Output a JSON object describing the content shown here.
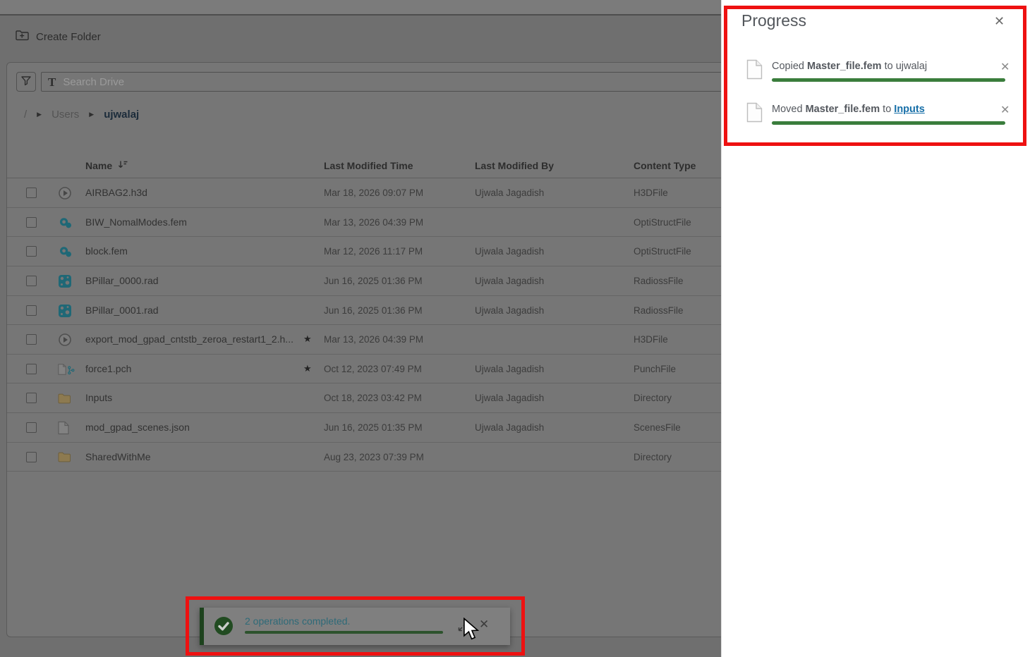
{
  "toolbar": {
    "create_folder_label": "Create Folder"
  },
  "search": {
    "placeholder": "Search Drive",
    "text_icon_glyph": "T"
  },
  "breadcrumb": {
    "root": "/",
    "parent": "Users",
    "current": "ujwalaj"
  },
  "table": {
    "columns": [
      "Name",
      "Last Modified Time",
      "Last Modified By",
      "Content Type"
    ],
    "rows": [
      {
        "name": "AIRBAG2.h3d",
        "icon": "h3d-play-icon",
        "starred": false,
        "modified": "Mar 18, 2026 09:07 PM",
        "modified_by": "Ujwala Jagadish",
        "content_type": "H3DFile"
      },
      {
        "name": "BIW_NomalModes.fem",
        "icon": "optistruct-icon",
        "starred": false,
        "modified": "Mar 13, 2026 04:39 PM",
        "modified_by": "",
        "content_type": "OptiStructFile"
      },
      {
        "name": "block.fem",
        "icon": "optistruct-icon",
        "starred": false,
        "modified": "Mar 12, 2026 11:17 PM",
        "modified_by": "Ujwala Jagadish",
        "content_type": "OptiStructFile"
      },
      {
        "name": "BPillar_0000.rad",
        "icon": "radioss-icon",
        "starred": false,
        "modified": "Jun 16, 2025 01:36 PM",
        "modified_by": "Ujwala Jagadish",
        "content_type": "RadiossFile"
      },
      {
        "name": "BPillar_0001.rad",
        "icon": "radioss-icon",
        "starred": false,
        "modified": "Jun 16, 2025 01:36 PM",
        "modified_by": "Ujwala Jagadish",
        "content_type": "RadiossFile"
      },
      {
        "name": "export_mod_gpad_cntstb_zeroa_restart1_2.h...",
        "icon": "h3d-play-icon",
        "starred": true,
        "modified": "Mar 13, 2026 04:39 PM",
        "modified_by": "",
        "content_type": "H3DFile"
      },
      {
        "name": "force1.pch",
        "icon": "punch-doc-icon",
        "starred": true,
        "modified": "Oct 12, 2023 07:49 PM",
        "modified_by": "Ujwala Jagadish",
        "content_type": "PunchFile"
      },
      {
        "name": "Inputs",
        "icon": "folder-icon",
        "starred": false,
        "modified": "Oct 18, 2023 03:42 PM",
        "modified_by": "Ujwala Jagadish",
        "content_type": "Directory"
      },
      {
        "name": "mod_gpad_scenes.json",
        "icon": "doc-icon",
        "starred": false,
        "modified": "Jun 16, 2025 01:35 PM",
        "modified_by": "Ujwala Jagadish",
        "content_type": "ScenesFile"
      },
      {
        "name": "SharedWithMe",
        "icon": "folder-icon",
        "starred": false,
        "modified": "Aug 23, 2023 07:39 PM",
        "modified_by": "",
        "content_type": "Directory"
      }
    ]
  },
  "toast": {
    "message": "2 operations completed.",
    "progress_percent": 100
  },
  "progress_panel": {
    "title": "Progress",
    "close_glyph": "✕",
    "items": [
      {
        "action": "Copied",
        "file": "Master_file.fem",
        "preposition": "to",
        "destination": "ujwalaj",
        "destination_is_link": false,
        "progress_percent": 100
      },
      {
        "action": "Moved",
        "file": "Master_file.fem",
        "preposition": "to",
        "destination": "Inputs",
        "destination_is_link": true,
        "progress_percent": 100
      }
    ]
  },
  "colors": {
    "progress_green": "#3a7d3c",
    "link_blue": "#176fa8",
    "annotation_red": "#ee1111",
    "toast_text_teal": "#2e6a78"
  }
}
